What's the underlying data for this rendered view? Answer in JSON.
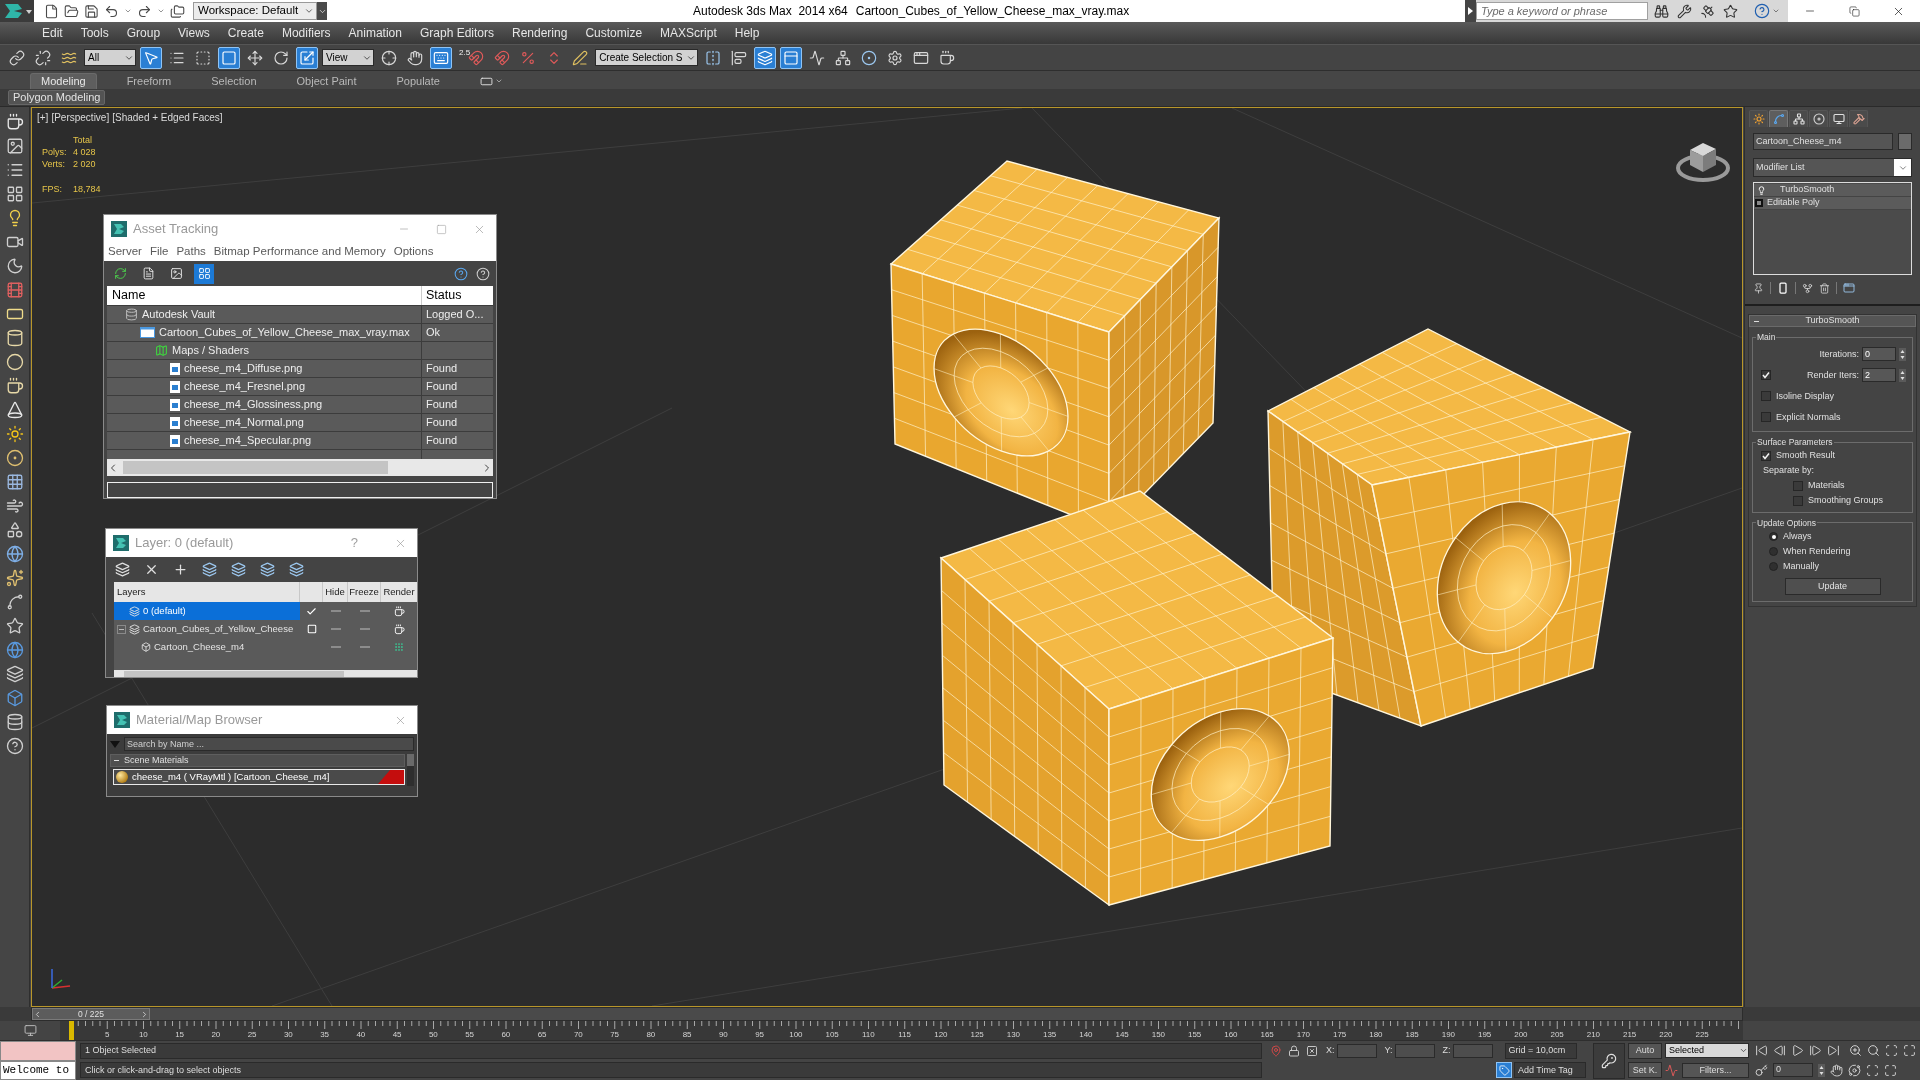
{
  "title_bar": {
    "workspace": "Workspace: Default",
    "app_name": "Autodesk 3ds Max  2014 x64",
    "file_name": "Cartoon_Cubes_of_Yellow_Cheese_max_vray.max",
    "search": {
      "placeholder": "Type a keyword or phrase"
    }
  },
  "menu_bar": [
    "Edit",
    "Tools",
    "Group",
    "Views",
    "Create",
    "Modifiers",
    "Animation",
    "Graph Editors",
    "Rendering",
    "Customize",
    "MAXScript",
    "Help"
  ],
  "main_toolbar": [
    {
      "kind": "button",
      "on": false
    },
    {
      "kind": "button",
      "on": false
    },
    {
      "kind": "button",
      "on": false
    },
    {
      "kind": "dropdown",
      "value": "All"
    },
    {
      "kind": "button",
      "on": true
    },
    {
      "kind": "button",
      "on": false
    },
    {
      "kind": "button",
      "on": false
    },
    {
      "kind": "button",
      "on": true
    },
    {
      "kind": "button",
      "on": false
    },
    {
      "kind": "button",
      "on": false
    },
    {
      "kind": "button",
      "on": true
    },
    {
      "kind": "dropdown",
      "value": "View"
    },
    {
      "kind": "button",
      "on": false
    },
    {
      "kind": "button",
      "on": false
    },
    {
      "kind": "button",
      "on": true
    },
    {
      "kind": "button",
      "on": false,
      "caption": "2.5"
    },
    {
      "kind": "button",
      "on": false
    },
    {
      "kind": "button",
      "on": false
    },
    {
      "kind": "button",
      "on": false
    },
    {
      "kind": "button",
      "on": false
    },
    {
      "kind": "dropdown",
      "value": "Create Selection S"
    },
    {
      "kind": "button",
      "on": false
    },
    {
      "kind": "button",
      "on": false
    },
    {
      "kind": "button",
      "on": true
    },
    {
      "kind": "button",
      "on": true
    },
    {
      "kind": "button",
      "on": false
    },
    {
      "kind": "button",
      "on": false
    },
    {
      "kind": "button",
      "on": false
    },
    {
      "kind": "button",
      "on": false
    },
    {
      "kind": "button",
      "on": false
    },
    {
      "kind": "button",
      "on": false
    }
  ],
  "ribbon": {
    "tabs": [
      {
        "label": "Modeling",
        "selected": true
      },
      {
        "label": "Freeform",
        "selected": false
      },
      {
        "label": "Selection",
        "selected": false
      },
      {
        "label": "Object Paint",
        "selected": false
      },
      {
        "label": "Populate",
        "selected": false
      }
    ],
    "panel": "Polygon Modeling"
  },
  "viewport": {
    "labels": [
      "[+]",
      "[Perspective]",
      "[Shaded + Edged Faces]"
    ],
    "stats": {
      "header": "Total",
      "rows": [
        {
          "label": "Polys:",
          "value": "4 028"
        },
        {
          "label": "Verts:",
          "value": "2 020"
        }
      ],
      "fps": {
        "label": "FPS:",
        "value": "18,784"
      }
    }
  },
  "asset_tracking": {
    "title": "Asset Tracking",
    "menu": [
      "Server",
      "File",
      "Paths",
      "Bitmap Performance and Memory",
      "Options"
    ],
    "view_buttons": [
      {
        "selected": false
      },
      {
        "selected": false
      },
      {
        "selected": false
      },
      {
        "selected": true
      }
    ],
    "columns": [
      "Name",
      "Status"
    ],
    "rows": [
      {
        "kind": "vault",
        "name": "Autodesk Vault",
        "status": "Logged O...",
        "children": [
          {
            "kind": "scene",
            "name": "Cartoon_Cubes_of_Yellow_Cheese_max_vray.max",
            "status": "Ok",
            "children": [
              {
                "kind": "maps",
                "name": "Maps / Shaders",
                "children": [
                  {
                    "kind": "image",
                    "name": "cheese_m4_Diffuse.png",
                    "status": "Found"
                  },
                  {
                    "kind": "image",
                    "name": "cheese_m4_Fresnel.png",
                    "status": "Found"
                  },
                  {
                    "kind": "image",
                    "name": "cheese_m4_Glossiness.png",
                    "status": "Found"
                  },
                  {
                    "kind": "image",
                    "name": "cheese_m4_Normal.png",
                    "status": "Found"
                  },
                  {
                    "kind": "image",
                    "name": "cheese_m4_Specular.png",
                    "status": "Found"
                  }
                ]
              }
            ]
          }
        ]
      }
    ]
  },
  "layer_manager": {
    "title": "Layer: 0 (default)",
    "help": "?",
    "columns": [
      "Layers",
      "Hide",
      "Freeze",
      "Render"
    ],
    "rows": [
      {
        "name": "0 (default)",
        "selected": true,
        "current": true
      },
      {
        "name": "Cartoon_Cubes_of_Yellow_Cheese",
        "selected": false,
        "current": false,
        "expanded": true,
        "children": [
          {
            "name": "Cartoon_Cheese_m4",
            "selected": false
          }
        ]
      }
    ]
  },
  "material_browser": {
    "title": "Material/Map Browser",
    "search": {
      "placeholder": "Search by Name ..."
    },
    "groups": [
      {
        "name": "Scene Materials",
        "expanded": true,
        "items": [
          "cheese_m4 ( VRayMtl ) [Cartoon_Cheese_m4]"
        ]
      }
    ]
  },
  "command_panel": {
    "tabs": [
      {
        "selected": false
      },
      {
        "selected": true
      },
      {
        "selected": false
      },
      {
        "selected": false
      },
      {
        "selected": false
      },
      {
        "selected": false
      }
    ],
    "object_name": "Cartoon_Cheese_m4",
    "modifier_list": "Modifier List",
    "stack": [
      {
        "kind": "modifier",
        "name": "TurboSmooth"
      },
      {
        "kind": "base",
        "name": "Editable Poly"
      }
    ],
    "rollout": {
      "title": "TurboSmooth",
      "expanded": true,
      "groups": [
        {
          "title": "Main",
          "controls": [
            {
              "kind": "spinner",
              "label": "Iterations:",
              "value": "0"
            },
            {
              "kind": "check_spinner",
              "label": "Render Iters:",
              "value": "2",
              "checked": true
            },
            {
              "kind": "checkbox",
              "label": "Isoline Display",
              "checked": false
            },
            {
              "kind": "checkbox",
              "label": "Explicit Normals",
              "checked": false
            }
          ]
        },
        {
          "title": "Surface Parameters",
          "controls": [
            {
              "kind": "checkbox",
              "label": "Smooth Result",
              "checked": true
            },
            {
              "kind": "label",
              "label": "Separate by:"
            },
            {
              "kind": "subcheckbox",
              "label": "Materials",
              "checked": false
            },
            {
              "kind": "subcheckbox",
              "label": "Smoothing Groups",
              "checked": false
            }
          ]
        },
        {
          "title": "Update Options",
          "controls": [
            {
              "kind": "radio",
              "label": "Always",
              "selected": true
            },
            {
              "kind": "radio",
              "label": "When Rendering",
              "selected": false
            },
            {
              "kind": "radio",
              "label": "Manually",
              "selected": false
            },
            {
              "kind": "button",
              "label": "Update"
            }
          ]
        }
      ]
    }
  },
  "timeline": {
    "slider": {
      "label": "0 / 225",
      "level": 0
    },
    "ticks": [
      "5",
      "10",
      "15",
      "20",
      "25",
      "30",
      "35",
      "40",
      "45",
      "50",
      "55",
      "60",
      "65",
      "70",
      "75",
      "80",
      "85",
      "90",
      "95",
      "100",
      "105",
      "110",
      "115",
      "120",
      "125",
      "130",
      "135",
      "140",
      "145",
      "150",
      "155",
      "160",
      "165",
      "170",
      "175",
      "180",
      "185",
      "190",
      "195",
      "200",
      "205",
      "210",
      "215",
      "220",
      "225"
    ]
  },
  "status_bar": {
    "listener": "Welcome to",
    "selection": "1 Object Selected",
    "prompt": "Click or click-and-drag to select objects",
    "coords": [
      "X:",
      "Y:",
      "Z:"
    ],
    "grid": "Grid = 10,0cm",
    "time_tag": "Add Time Tag",
    "auto_key": "Auto",
    "key_filter": "Selected",
    "set_key": "Set K.",
    "filters": "Filters...",
    "frame": "0"
  }
}
